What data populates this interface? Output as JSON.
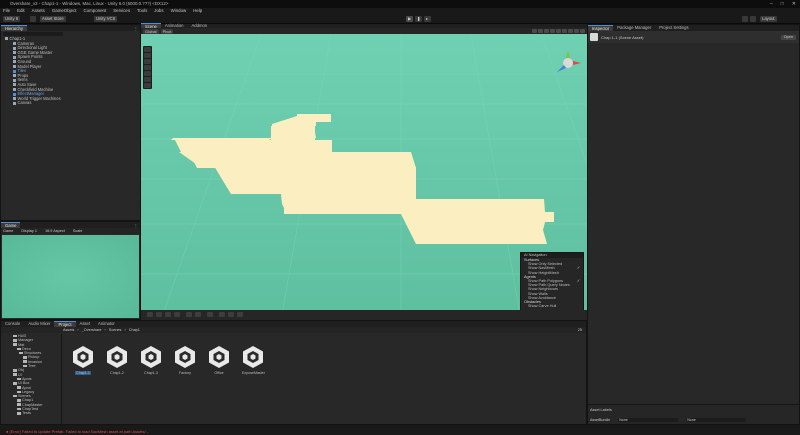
{
  "window": {
    "title": "Overshare_v2 - Chap1-1 - Windows, Mac, Linux - Unity 6.0 (6000.0.???) <DX12>"
  },
  "menu": [
    "File",
    "Edit",
    "Assets",
    "GameObject",
    "Component",
    "Services",
    "Tools",
    "Jobs",
    "Window",
    "Help"
  ],
  "toolbar": {
    "account": "Unity 6",
    "store": "Asset Store",
    "vcs": "Unity VCS",
    "layout": "Layout",
    "play_icon": "play-icon",
    "pause_icon": "pause-icon",
    "step_icon": "step-icon"
  },
  "hierarchy": {
    "tab": "Hierarchy",
    "items": [
      {
        "label": "Chap1-1",
        "blue": false
      },
      {
        "label": "Cameras",
        "blue": false
      },
      {
        "label": "Directional Light",
        "blue": false
      },
      {
        "label": "GGE Game Master",
        "blue": false
      },
      {
        "label": "Spawn Points",
        "blue": false
      },
      {
        "label": "Ground",
        "blue": false
      },
      {
        "label": "Model Player",
        "blue": false
      },
      {
        "label": "Tiles",
        "blue": true
      },
      {
        "label": "Props",
        "blue": false
      },
      {
        "label": "Items",
        "blue": false
      },
      {
        "label": "Auto Save",
        "blue": false
      },
      {
        "label": "Checkfield Machine",
        "blue": false
      },
      {
        "label": "EffectManager",
        "blue": true
      },
      {
        "label": "World Trigger Machines",
        "blue": false
      },
      {
        "label": "Canvas",
        "blue": false
      }
    ]
  },
  "game": {
    "tab": "Game",
    "display": "Game",
    "display_num": "Display 1",
    "aspect": "16:9 Aspect",
    "scale": "Scale"
  },
  "scene": {
    "tabs": [
      "Scene",
      "Animation",
      "Addmon"
    ],
    "mode": "Global",
    "pivot": "Pivot",
    "overlay": {
      "title": "AI Navigation",
      "sections": [
        {
          "name": "Surfaces",
          "options": [
            {
              "label": "Show Only Selected",
              "checked": false
            },
            {
              "label": "Show NavMesh",
              "checked": true
            },
            {
              "label": "Show HeightMesh",
              "checked": false
            }
          ]
        },
        {
          "name": "Agents",
          "options": [
            {
              "label": "Show Path Polygons",
              "checked": true
            },
            {
              "label": "Show Path Query Nodes",
              "checked": false
            },
            {
              "label": "Show Neighbours",
              "checked": false
            },
            {
              "label": "Show Walls",
              "checked": false
            },
            {
              "label": "Show Avoidance",
              "checked": false
            }
          ]
        },
        {
          "name": "Obstacles",
          "options": [
            {
              "label": "Show Carve Hull",
              "checked": false
            }
          ]
        }
      ]
    }
  },
  "inspector": {
    "tabs": [
      "Inspector",
      "Package Manager",
      "Project Settings"
    ],
    "object": "Chap 1-1 (Scene Asset)",
    "open_button": "Open",
    "asset_labels": "Asset Labels",
    "asset_bundle": "AssetBundle",
    "none1": "None",
    "none2": "None"
  },
  "project": {
    "tabs": [
      "Console",
      "Audio Mixer",
      "Project",
      "Asset",
      "Animator"
    ],
    "breadcrumb": [
      "Assets",
      "_Overshare",
      "Scenes",
      "Chap1"
    ],
    "search_count": "25",
    "tree": [
      "HUD",
      "Manager",
      "Mat",
      "Deco",
      "Structures",
      "Pickup",
      "Invasion",
      "Tree",
      "Obj",
      "UI",
      "Apois",
      "UI Box",
      "Aprol",
      "Legacy",
      "Scenes",
      "Chap1",
      "ChapMaster",
      "ChapTest",
      "Tests"
    ],
    "assets": [
      "Chap1-1",
      "Chap1-2",
      "Chap1-3",
      "Factory",
      "Office",
      "ExposeMaster"
    ]
  },
  "status": {
    "text": "[Error] Failed to update Prefab. Failed to load NavMesh asset at path Assets/..."
  },
  "colors": {
    "viewport": "#64c6a6",
    "tiles": "#fbeec0",
    "accent": "#4f8fd8",
    "error": "#e84a4a"
  }
}
